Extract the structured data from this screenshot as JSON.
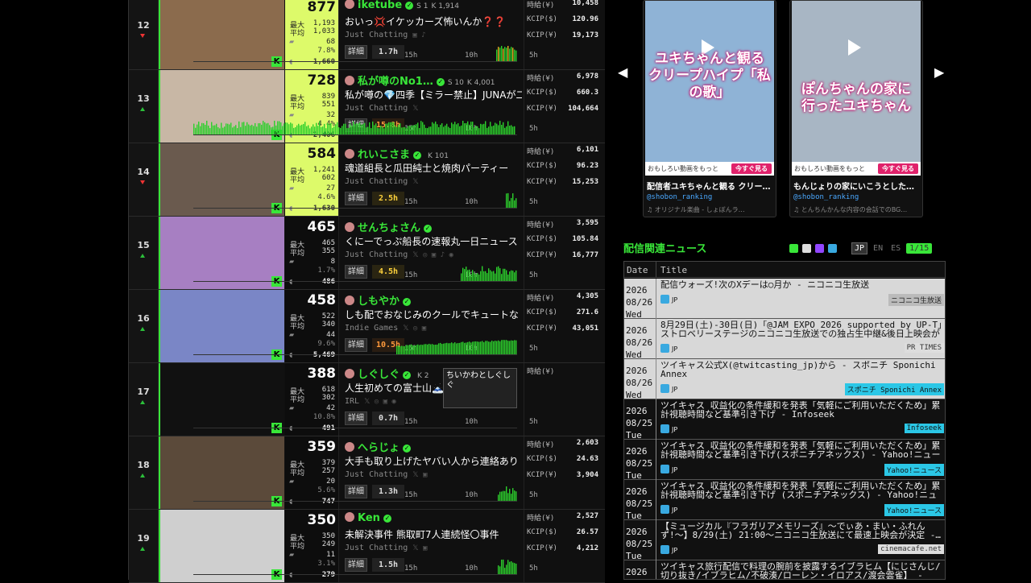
{
  "ranking": [
    {
      "rank": "12",
      "trend": "down",
      "viewers": "877",
      "highlight": true,
      "max_label": "最大",
      "max": "1,193",
      "avg_label": "平均",
      "avg": "1,033",
      "comments": "68",
      "ratio": "7.8%",
      "total": "1,660",
      "name": "iketube",
      "meta1": "S 1",
      "meta2": "K 1,914",
      "title": "おいっ💢イケッカーズ怖いんか❓❓",
      "category": "Just Chatting",
      "social": "▣ ♪",
      "hours": "1.7h",
      "hours_style": "",
      "r1_label": "時給(¥)",
      "r1": "10,458",
      "r2_label": "KCIP($)",
      "r2": "120.96",
      "r3_label": "KCIP(¥)",
      "r3": "19,173",
      "thumb_color": "#8b6b4d",
      "graph": [
        0,
        0,
        0,
        0,
        0,
        0,
        0,
        0,
        0,
        0,
        0,
        0,
        0,
        0,
        0,
        0,
        0,
        0,
        0,
        0,
        0,
        0,
        0,
        0,
        0,
        0,
        0,
        0,
        0,
        0,
        0,
        0,
        0,
        0,
        0,
        0,
        0,
        0,
        0,
        0,
        0,
        0,
        0,
        0,
        0,
        0,
        0,
        0,
        0,
        0,
        0,
        0,
        0,
        0,
        0,
        0,
        0,
        0,
        0,
        0,
        0,
        0,
        0,
        0,
        0,
        0,
        0,
        0,
        0,
        0,
        0,
        0,
        0,
        0,
        0,
        0,
        0,
        0,
        0,
        0,
        0,
        0,
        0,
        0,
        0,
        0,
        0,
        0,
        0,
        0,
        0,
        0,
        0,
        0,
        0,
        0,
        0,
        0,
        0,
        0,
        0,
        0,
        0,
        0,
        0,
        0,
        0,
        0,
        0,
        0,
        0,
        0,
        0,
        0,
        0,
        0,
        0,
        0,
        0,
        0,
        0,
        0,
        0,
        0,
        0,
        0,
        0,
        0,
        0,
        0,
        0,
        0,
        0,
        0,
        0,
        0,
        0,
        0,
        0,
        0,
        0,
        0,
        0,
        0,
        0,
        0,
        0,
        0,
        0,
        0,
        0,
        0,
        0,
        0,
        0,
        0,
        0,
        0,
        0,
        0,
        0,
        0,
        0,
        0,
        0,
        0,
        0,
        0,
        0,
        0,
        0,
        0,
        0,
        0,
        0,
        0,
        0,
        0,
        0,
        0,
        0,
        0,
        0,
        0,
        0,
        0,
        0,
        0,
        0,
        0,
        0,
        0,
        0,
        0,
        0,
        0,
        0,
        0,
        0,
        0,
        0,
        0,
        0,
        0,
        0,
        0,
        0,
        0,
        0,
        0,
        0,
        0,
        0,
        0,
        0,
        0,
        0,
        0,
        0,
        0,
        0,
        0,
        0,
        0,
        0,
        0,
        0,
        0,
        0,
        0,
        0,
        0,
        0,
        0,
        0,
        0,
        0,
        0,
        0,
        0,
        0,
        0,
        0,
        0,
        0,
        0,
        0,
        0,
        0,
        0,
        0,
        0,
        0,
        0,
        0,
        0,
        0,
        0,
        0,
        0,
        0,
        0,
        0,
        0,
        0,
        0,
        0,
        0,
        0,
        0,
        0,
        0,
        0,
        0,
        0,
        0,
        0,
        0,
        0,
        0,
        0,
        0,
        0,
        0,
        0,
        0,
        0,
        0,
        0,
        0,
        0,
        0,
        0,
        0,
        0,
        0,
        0,
        0,
        0,
        0,
        0,
        0,
        0,
        0,
        0,
        0,
        0,
        0,
        0,
        0,
        0,
        0,
        0,
        0,
        0,
        0,
        0,
        0,
        0,
        0,
        0,
        0,
        0,
        0,
        0,
        0,
        0,
        0,
        0,
        0,
        0,
        0,
        0,
        0,
        0,
        0,
        0,
        0,
        0,
        0,
        0,
        0,
        0,
        0,
        0,
        0,
        0,
        0,
        0,
        0,
        0,
        0,
        0,
        0,
        0,
        0,
        0,
        0,
        0,
        0,
        0,
        0,
        0,
        0,
        0,
        0,
        0,
        0,
        0,
        0,
        0,
        0,
        0,
        0,
        0,
        0,
        0,
        0,
        0,
        0,
        0,
        0,
        0,
        0,
        0,
        0,
        0,
        0,
        0,
        0,
        0,
        0,
        0,
        0,
        0,
        0,
        0,
        0,
        0,
        0,
        0,
        0,
        0,
        0,
        0,
        0,
        0,
        0,
        0,
        0,
        0,
        0,
        0,
        0,
        0,
        0,
        0,
        0,
        0,
        0,
        0,
        0,
        0,
        0,
        0,
        0,
        0,
        0,
        0,
        0,
        0,
        0.6,
        0.9,
        0.8,
        1,
        0.7,
        0.9,
        0.8,
        1,
        0.7,
        0.9,
        0.8,
        0.6,
        0.5
      ]
    },
    {
      "rank": "13",
      "trend": "up",
      "viewers": "728",
      "highlight": true,
      "max_label": "最大",
      "max": "839",
      "avg_label": "平均",
      "avg": "551",
      "comments": "32",
      "ratio": "4.4%",
      "total": "2,406",
      "name": "私が噂のNo1…",
      "meta1": "S 10",
      "meta2": "K 4,001",
      "title": "私が噂の💎四季【ミラー禁止】JUNAが二",
      "category": "Just Chatting",
      "social": "𝕏",
      "hours": "15.8h",
      "hours_style": "orange",
      "r1_label": "時給(¥)",
      "r1": "6,978",
      "r2_label": "KCIP($)",
      "r2": "660.3",
      "r3_label": "KCIP(¥)",
      "r3": "104,664",
      "thumb_color": "#c8b7a5",
      "graph": "full"
    },
    {
      "rank": "14",
      "trend": "down",
      "viewers": "584",
      "highlight": true,
      "max_label": "最大",
      "max": "1,241",
      "avg_label": "平均",
      "avg": "602",
      "comments": "27",
      "ratio": "4.6%",
      "total": "1,630",
      "name": "れいこさま",
      "meta1": "",
      "meta2": "K 101",
      "title": "魂道組長と瓜田純士と焼肉パーティー",
      "category": "Just Chatting",
      "social": "𝕏",
      "hours": "2.5h",
      "hours_style": "yellow",
      "r1_label": "時給(¥)",
      "r1": "6,101",
      "r2_label": "KCIP($)",
      "r2": "96.23",
      "r3_label": "KCIP(¥)",
      "r3": "15,253",
      "thumb_color": "#6a5a4e",
      "graph": "tail"
    },
    {
      "rank": "15",
      "trend": "up",
      "viewers": "465",
      "highlight": false,
      "max_label": "最大",
      "max": "465",
      "avg_label": "平均",
      "avg": "355",
      "comments": "8",
      "ratio": "1.7%",
      "total": "486",
      "name": "せんちょさん",
      "meta1": "",
      "meta2": "",
      "title": "くにーでっぷ船長の速報丸一日ニュース",
      "category": "Just Chatting",
      "social": "𝕏 ◎ ▣ ♪ ◉",
      "hours": "4.5h",
      "hours_style": "yellow",
      "r1_label": "時給(¥)",
      "r1": "3,595",
      "r2_label": "KCIP($)",
      "r2": "105.84",
      "r3_label": "KCIP(¥)",
      "r3": "16,777",
      "thumb_color": "#a77fc2",
      "graph": "half"
    },
    {
      "rank": "16",
      "trend": "up",
      "viewers": "458",
      "highlight": false,
      "max_label": "最大",
      "max": "522",
      "avg_label": "平均",
      "avg": "340",
      "comments": "44",
      "ratio": "9.6%",
      "total": "5,469",
      "name": "しもやか",
      "meta1": "",
      "meta2": "",
      "title": "しも配でおなじみのクールでキュートな",
      "category": "Indie Games",
      "social": "𝕏 ◎ ▣",
      "hours": "10.5h",
      "hours_style": "orange",
      "r1_label": "時給(¥)",
      "r1": "4,305",
      "r2_label": "KCIP($)",
      "r2": "271.6",
      "r3_label": "KCIP(¥)",
      "r3": "43,051",
      "thumb_color": "#7a86c6",
      "graph": "long"
    },
    {
      "rank": "17",
      "trend": "up",
      "viewers": "388",
      "highlight": false,
      "max_label": "最大",
      "max": "618",
      "avg_label": "平均",
      "avg": "302",
      "comments": "42",
      "ratio": "10.8%",
      "total": "491",
      "name": "しぐしぐ",
      "meta1": "",
      "meta2": "K 2",
      "title": "人生初めての富士山🗻",
      "category": "IRL",
      "social": "𝕏 ◎ ▣ ◉",
      "hours": "0.7h",
      "hours_style": "",
      "r1_label": "時給(¥)",
      "r1": "",
      "r2_label": "",
      "r2": "",
      "r3_label": "",
      "r3": "",
      "thumb_color": "#111",
      "graph": "none",
      "clip": "ちいかわとしぐしぐ"
    },
    {
      "rank": "18",
      "trend": "up",
      "viewers": "359",
      "highlight": false,
      "max_label": "最大",
      "max": "379",
      "avg_label": "平均",
      "avg": "257",
      "comments": "20",
      "ratio": "5.6%",
      "total": "747",
      "name": "へらじょ",
      "meta1": "",
      "meta2": "",
      "title": "大手も取り上げたヤバい人から連絡あり",
      "category": "Just Chatting",
      "social": "𝕏 ▣",
      "hours": "1.3h",
      "hours_style": "",
      "r1_label": "時給(¥)",
      "r1": "2,603",
      "r2_label": "KCIP($)",
      "r2": "24.63",
      "r3_label": "KCIP(¥)",
      "r3": "3,904",
      "thumb_color": "#5b4a3a",
      "graph": "tiny"
    },
    {
      "rank": "19",
      "trend": "up",
      "viewers": "350",
      "highlight": false,
      "max_label": "最大",
      "max": "350",
      "avg_label": "平均",
      "avg": "249",
      "comments": "11",
      "ratio": "3.1%",
      "total": "279",
      "name": "Ken",
      "meta1": "",
      "meta2": "",
      "title": "未解決事件 熊取町7人連続怪〇事件",
      "category": "Just Chatting",
      "social": "𝕏 ▣",
      "hours": "1.5h",
      "hours_style": "",
      "r1_label": "時給(¥)",
      "r1": "2,527",
      "r2_label": "KCIP($)",
      "r2": "26.57",
      "r3_label": "KCIP(¥)",
      "r3": "4,212",
      "thumb_color": "#cfcfcf",
      "graph": "tiny"
    }
  ],
  "ticks": [
    "15h",
    "10h",
    "5h"
  ],
  "detail_label": "詳細",
  "videos": [
    {
      "overlay": "ユキちゃんと観る クリープハイプ「私の歌」",
      "cta_text": "おもしろい動画をもっと",
      "cta_btn": "今すぐ見る",
      "title": "配信者ユキちゃんと観る クリー…",
      "user": "@shobon_ranking",
      "music": "♫ オリジナル楽曲 - しょぼんラ…"
    },
    {
      "overlay": "ぽんちゃんの家に行ったユキちゃん",
      "cta_text": "おもしろい動画をもっと",
      "cta_btn": "今すぐ見る",
      "title": "もんじょりの家にいこうとした…",
      "user": "@shobon_ranking",
      "music": "♫ とんちんかんな内容の会話でのBG…"
    }
  ],
  "news": {
    "heading": "配信関連ニュース",
    "langs": [
      "JP",
      "EN",
      "ES"
    ],
    "count": "1/15",
    "col_date": "Date",
    "col_title": "Title",
    "items": [
      {
        "y": "2026",
        "md": "08/26",
        "wd": "Wed",
        "title": "配信ウォーズ!次のXデーは○月か - ニコニコ生放送",
        "lang": "JP",
        "source": "ニコニコ生放送",
        "style": "lt",
        "src": "grey"
      },
      {
        "y": "2026",
        "md": "08/26",
        "wd": "Wed",
        "title": "8月29日(土)-30日(日)「@JAM EXPO 2026 supported by UP-T」ストロベリーステージのニコニコ生放送での独占生中継&後日上映会が決…",
        "lang": "JP",
        "source": "PR TIMES",
        "style": "lt",
        "src": "lightgrey"
      },
      {
        "y": "2026",
        "md": "08/26",
        "wd": "Wed",
        "title": "ツイキャス公式X(@twitcasting_jp)から - スポニチ Sponichi Annex",
        "lang": "JP",
        "source": "スポニチ Sponichi Annex",
        "style": "lt",
        "src": "cyan"
      },
      {
        "y": "2026",
        "md": "08/25",
        "wd": "Tue",
        "title": "ツイキャス 収益化の条件緩和を発表「気軽にご利用いただくため」累計視聴時間など基準引き下げ - Infoseek",
        "lang": "JP",
        "source": "Infoseek",
        "style": "dk",
        "src": "cyan"
      },
      {
        "y": "2026",
        "md": "08/25",
        "wd": "Tue",
        "title": "ツイキャス 収益化の条件緩和を発表「気軽にご利用いただくため」累計視聴時間など基準引き下げ(スポニチアネックス) - Yahoo!ニュース",
        "lang": "JP",
        "source": "Yahoo!ニュース",
        "style": "dk",
        "src": "cyan"
      },
      {
        "y": "2026",
        "md": "08/25",
        "wd": "Tue",
        "title": "ツイキャス 収益化の条件緩和を発表「気軽にご利用いただくため」累計視聴時間など基準引き下げ (スポニチアネックス) - Yahoo!ニュース",
        "lang": "JP",
        "source": "Yahoo!ニュース",
        "style": "dk",
        "src": "cyan"
      },
      {
        "y": "2026",
        "md": "08/25",
        "wd": "Tue",
        "title": "【ミュージカル『フラガリアメモリーズ』〜でぃあ・まい・ふれんず!〜】8/29(土) 21:00〜ニコニコ生放送にて最速上映会が決定 -…",
        "lang": "JP",
        "source": "cinemacafe.net",
        "style": "dk",
        "src": "lightgrey"
      },
      {
        "y": "2026",
        "md": "08/24",
        "wd": "",
        "title": "ツイキャス旅行配信で料理の腕前を披露するイブラヒム【にじさんじ/切り抜き/イブラヒム/不破湊/ローレン・イロアス/渡会雲雀】 - YouTube",
        "lang": "",
        "source": "",
        "style": "dk",
        "src": "cyan"
      }
    ]
  }
}
